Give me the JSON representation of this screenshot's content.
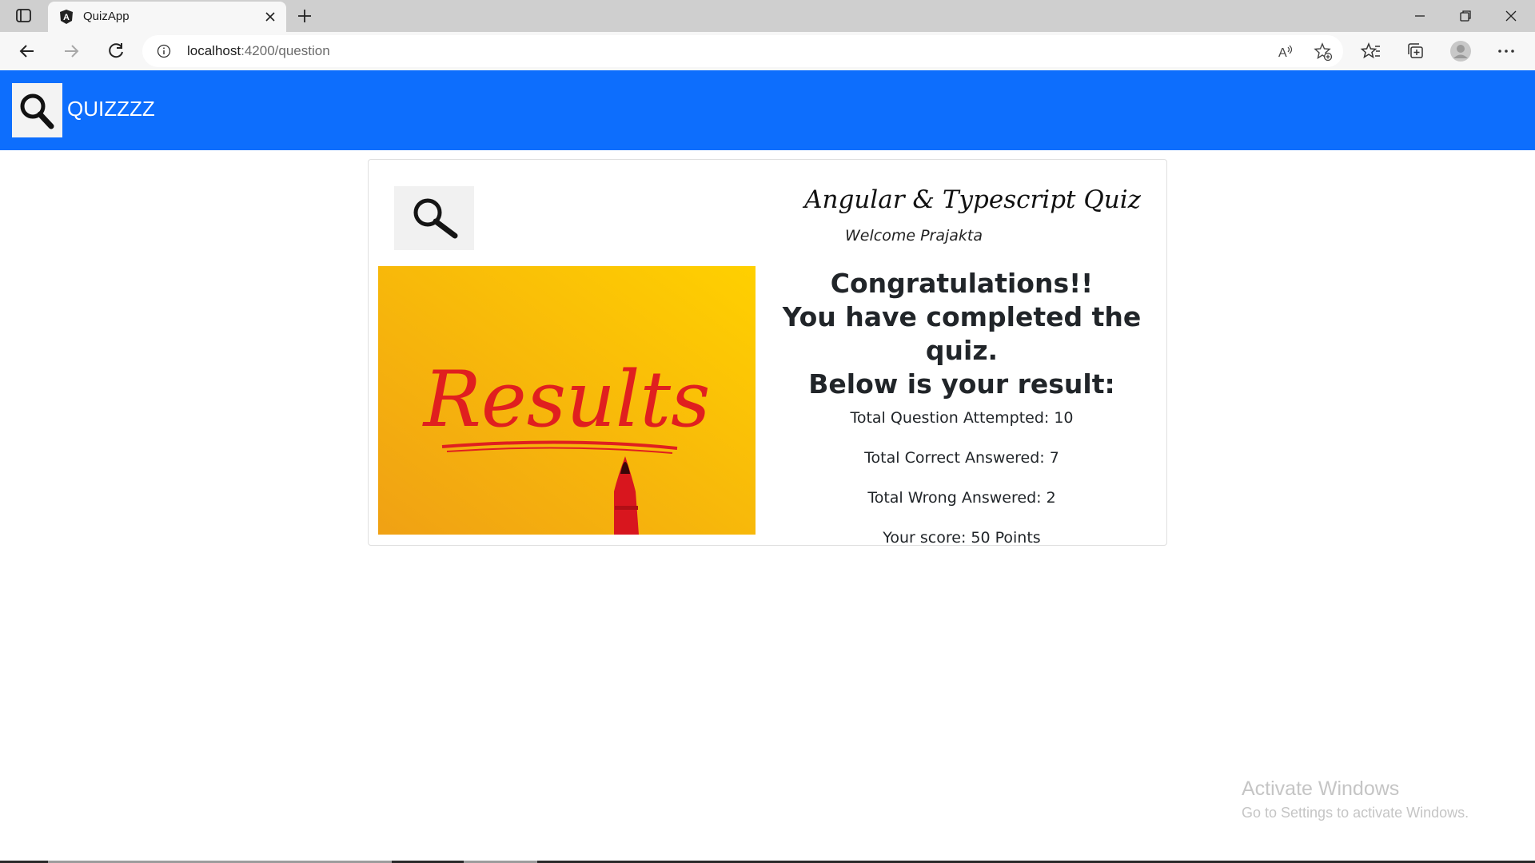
{
  "browser": {
    "tab_title": "QuizApp",
    "url_host": "localhost",
    "url_path": ":4200/question",
    "icons": {
      "tab_actions": "tab-actions-icon",
      "favicon": "angular-icon",
      "tab_close": "close-icon",
      "new_tab": "plus-icon",
      "minimize": "minimize-icon",
      "restore": "restore-icon",
      "close_window": "close-icon",
      "back": "back-arrow-icon",
      "forward": "forward-arrow-icon",
      "refresh": "refresh-icon",
      "site_info": "info-icon",
      "read_aloud": "read-aloud-icon",
      "add_favorite": "star-plus-icon",
      "favorites": "favorites-icon",
      "collections": "collections-icon",
      "profile": "profile-icon",
      "more": "more-icon"
    }
  },
  "navbar": {
    "brand": "QUIZZZZ",
    "background": "#0d6efd",
    "logo_icon": "magnifier-icon"
  },
  "quiz": {
    "title": "Angular & Typescript Quiz",
    "welcome": "Welcome Prajakta",
    "image_text": "Results",
    "congrats_line1": "Congratulations!!",
    "congrats_line2": "You have completed the quiz.",
    "congrats_line3": "Below is your result:",
    "stats": {
      "attempted": "Total Question Attempted: 10",
      "correct": "Total Correct Answered: 7",
      "wrong": "Total Wrong Answered: 2",
      "score": "Your score: 50 Points"
    }
  },
  "watermark": {
    "title": "Activate Windows",
    "subtitle": "Go to Settings to activate Windows."
  }
}
